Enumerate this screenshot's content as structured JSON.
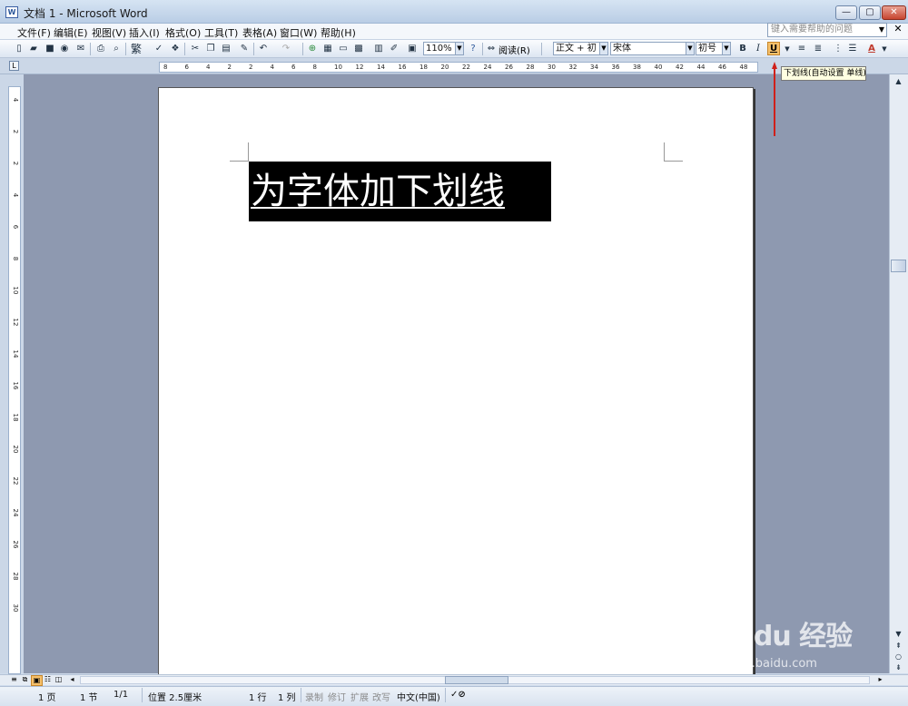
{
  "window": {
    "title": "文档 1 - Microsoft Word",
    "app_icon": "W",
    "min": "—",
    "max": "▢",
    "close": "✕"
  },
  "menu": [
    "文件(F)",
    "编辑(E)",
    "视图(V)",
    "插入(I)",
    "格式(O)",
    "工具(T)",
    "表格(A)",
    "窗口(W)",
    "帮助(H)"
  ],
  "help_search": {
    "placeholder": "键入需要帮助的问题"
  },
  "toolbar": {
    "traditional": "繁",
    "zoom": "110%",
    "read_label": "阅读(R)",
    "style": "正文 + 初号",
    "font": "宋体",
    "size": "初号",
    "bold": "B",
    "italic": "I",
    "underline": "U",
    "font_color": "A"
  },
  "tooltip": "下划线(自动设置 单线)",
  "ruler": {
    "corner": "L",
    "h_ticks": [
      "8",
      "6",
      "4",
      "2",
      "2",
      "4",
      "6",
      "8",
      "10",
      "12",
      "14",
      "16",
      "18",
      "20",
      "22",
      "24",
      "26",
      "28",
      "30",
      "32",
      "34",
      "36",
      "38",
      "40",
      "42",
      "44",
      "46",
      "48"
    ],
    "v_ticks": [
      "4",
      "2",
      "2",
      "4",
      "6",
      "8",
      "10",
      "12",
      "14",
      "16",
      "18",
      "20",
      "22",
      "24",
      "26",
      "28",
      "30"
    ]
  },
  "document": {
    "text": "为字体加下划线"
  },
  "status": {
    "page": "1 页",
    "section": "1 节",
    "pages": "1/1",
    "position": "位置 2.5厘米",
    "line": "1 行",
    "column": "1 列",
    "rec": "录制",
    "trk": "修订",
    "ext": "扩展",
    "ovr": "改写",
    "lang": "中文(中国)"
  },
  "watermark": {
    "brand": "Bai du 经验",
    "url": "jingyan.baidu.com"
  },
  "colors": {
    "accent": "#c0392b",
    "highlight": "#f6c06a",
    "selection": "#000000",
    "workspace": "#8e99b0"
  }
}
